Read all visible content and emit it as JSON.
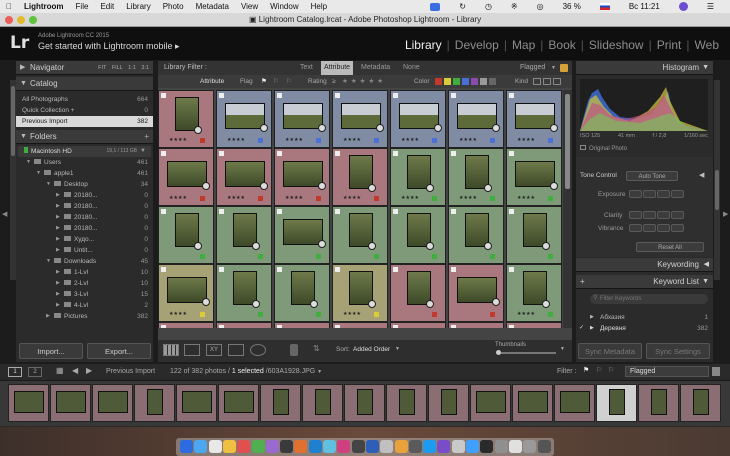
{
  "menubar": {
    "app_name": "Lightroom",
    "items": [
      "File",
      "Edit",
      "Library",
      "Photo",
      "Metadata",
      "View",
      "Window",
      "Help"
    ],
    "battery": "36 %",
    "clock": "Вс 11:21"
  },
  "window": {
    "title": "Lightroom Catalog.lrcat - Adobe Photoshop Lightroom - Library"
  },
  "identity": {
    "logo": "Lr",
    "version": "Adobe Lightroom CC 2015",
    "mobile": "Get started with Lightroom mobile ▸"
  },
  "modules": [
    {
      "label": "Library"
    },
    {
      "label": "Develop"
    },
    {
      "label": "Map"
    },
    {
      "label": "Book"
    },
    {
      "label": "Slideshow"
    },
    {
      "label": "Print"
    },
    {
      "label": "Web"
    }
  ],
  "left_panel": {
    "navigator": {
      "title": "Navigator",
      "zoom_options": [
        "FIT",
        "FILL",
        "1:1",
        "3:1"
      ]
    },
    "catalog": {
      "title": "Catalog",
      "items": [
        {
          "label": "All Photographs",
          "count": "664"
        },
        {
          "label": "Quick Collection +",
          "count": "0"
        },
        {
          "label": "Previous Import",
          "count": "382"
        }
      ]
    },
    "folders": {
      "title": "Folders",
      "drive": {
        "label": "Macintosh HD",
        "size": "19,1 / 113 GB"
      },
      "items": [
        {
          "label": "Users",
          "count": "461"
        },
        {
          "label": "apple1",
          "count": "461"
        },
        {
          "label": "Desktop",
          "count": "34"
        },
        {
          "label": "20180...",
          "count": "0"
        },
        {
          "label": "20180...",
          "count": "0"
        },
        {
          "label": "20180...",
          "count": "0"
        },
        {
          "label": "20180...",
          "count": "0"
        },
        {
          "label": "Худо...",
          "count": "0"
        },
        {
          "label": "Untit...",
          "count": "0"
        },
        {
          "label": "Downloads",
          "count": "45"
        },
        {
          "label": "1-Lvl",
          "count": "10"
        },
        {
          "label": "2-Lvl",
          "count": "10"
        },
        {
          "label": "3-Lvl",
          "count": "15"
        },
        {
          "label": "4-Lvl",
          "count": "2"
        },
        {
          "label": "Pictures",
          "count": "382"
        }
      ]
    },
    "import_button": "Import...",
    "export_button": "Export..."
  },
  "library_filter": {
    "title": "Library Filter :",
    "tabs": [
      "Text",
      "Attribute",
      "Metadata",
      "None"
    ],
    "preset": "Flagged",
    "attribute_row": {
      "attribute": "Attribute",
      "flag": "Flag",
      "rating": "Rating",
      "color": "Color",
      "kind": "Kind"
    }
  },
  "toolbar": {
    "sort_label": "Sort:",
    "sort_value": "Added Order",
    "thumbnails_label": "Thumbnails"
  },
  "right_panel": {
    "histogram": {
      "title": "Histogram",
      "iso": "ISO 125",
      "focal": "41 mm",
      "aperture": "f / 2,8",
      "shutter": "1/160 sec",
      "original": "Original Photo"
    },
    "quick_develop": {
      "tone_control": "Tone Control",
      "auto_tone": "Auto Tone",
      "exposure": "Exposure",
      "clarity": "Clarity",
      "vibrance": "Vibrance",
      "reset": "Reset All"
    },
    "keywording": {
      "title": "Keywording"
    },
    "keyword_list": {
      "title": "Keyword List",
      "filter_placeholder": "Filter Keywords",
      "items": [
        {
          "label": "Абхазия",
          "count": "1"
        },
        {
          "label": "Деревня",
          "count": "382"
        }
      ]
    },
    "sync_metadata": "Sync Metadata",
    "sync_settings": "Sync Settings"
  },
  "filmstrip_bar": {
    "screen1": "1",
    "screen2": "2",
    "source": "Previous Import",
    "info_prefix": "122 of 382 photos /",
    "selected": "1 selected",
    "filename": "/603A1928.JPG",
    "filter_label": "Filter :",
    "filter_value": "Flagged"
  },
  "colors": {
    "accent": "#e0e0e0",
    "red_label": "#c0392b",
    "green_label": "#3fae3f",
    "blue_label": "#4a6fd6",
    "yellow_label": "#d9cc3a",
    "cell_red": "#a8787e",
    "cell_green": "#7e9a78",
    "cell_blue": "#7f8ca4",
    "cell_yellow": "#a7a276"
  }
}
